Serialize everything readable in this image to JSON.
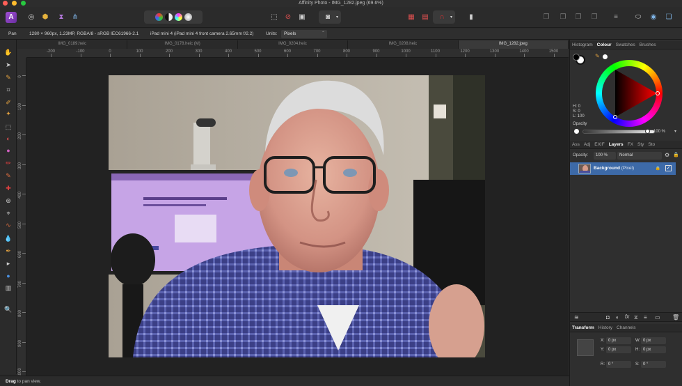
{
  "window": {
    "title": "Affinity Photo - IMG_1282.jpeg (69.6%)"
  },
  "context": {
    "tool": "Pan",
    "doc_info": "1280 × 960px, 1.23MP, RGBA/8 - sRGB IEC61966-2.1",
    "camera": "iPad mini 4 (iPad mini 4 front camera 2.65mm f/2.2)",
    "units_label": "Units:",
    "units_value": "Pixels"
  },
  "tabs": [
    {
      "label": "IMG_0189.heic"
    },
    {
      "label": "IMG_0178.heic (M)"
    },
    {
      "label": "IMG_0204.heic"
    },
    {
      "label": "IMG_0208.heic"
    },
    {
      "label": "IMG_1282.jpeg",
      "active": true
    }
  ],
  "rulers": {
    "top": [
      "-200",
      "-100",
      "0",
      "100",
      "200",
      "300",
      "400",
      "500",
      "600",
      "700",
      "800",
      "900",
      "1000",
      "1100",
      "1200",
      "1300",
      "1400",
      "1500"
    ],
    "left": [
      "0",
      "100",
      "200",
      "300",
      "400",
      "500",
      "600",
      "700",
      "800",
      "900",
      "1000"
    ]
  },
  "colour_panel": {
    "tabs": [
      "Histogram",
      "Colour",
      "Swatches",
      "Brushes"
    ],
    "active_tab": "Colour",
    "h": "H: 0",
    "s": "S: 0",
    "l": "L: 100",
    "opacity_label": "Opacity",
    "opacity_value": "100 %"
  },
  "layers_panel": {
    "tabs": [
      "Ass",
      "Adj",
      "EXIF",
      "Layers",
      "FX",
      "Sty",
      "Sto"
    ],
    "active_tab": "Layers",
    "opacity_label": "Opacity:",
    "opacity_value": "100 %",
    "blend_mode": "Normal",
    "layer_name": "Background",
    "layer_type": "(Pixel)"
  },
  "transform_panel": {
    "tabs": [
      "Transform",
      "History",
      "Channels"
    ],
    "active_tab": "Transform",
    "x_label": "X:",
    "x_value": "0 px",
    "y_label": "Y:",
    "y_value": "0 px",
    "w_label": "W:",
    "w_value": "0 px",
    "h_label": "H:",
    "h_value": "0 px",
    "r_label": "R:",
    "r_value": "0 °",
    "s_label": "S:",
    "s_value": "0 °"
  },
  "status": {
    "bold": "Drag",
    "text": " to pan view."
  }
}
